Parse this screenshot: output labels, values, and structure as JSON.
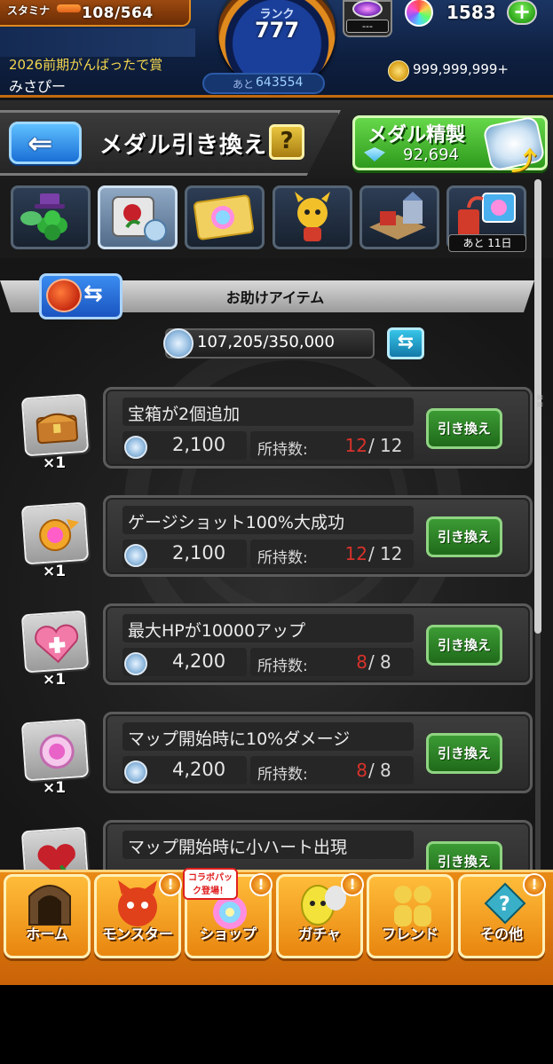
{
  "status": {
    "stamina_label": "スタミナ",
    "stamina_value": "108/564",
    "stamina_fraction": 0.19,
    "rank_label": "ランク",
    "rank_value": "777",
    "rank_next_label": "あと",
    "rank_next_value": "643554",
    "gem_value": "---",
    "orb_value": "1583",
    "orb_plus": "+",
    "title": "2026前期がんばったで賞",
    "username": "みさぴー",
    "coin_value": "999,999,999+"
  },
  "header": {
    "back_icon": "arrow-left-icon",
    "title": "メダル引き換え",
    "help_label": "?",
    "refine_label": "メダル精製",
    "refine_count": "92,694"
  },
  "tabs": {
    "timer": "あと 11日"
  },
  "section": {
    "title": "お助けアイテム",
    "medal_total": "107,205/350,000",
    "sort_icon": "swap-arrows-icon"
  },
  "items": [
    {
      "name": "宝箱が2個追加",
      "qty": "×1",
      "cost": "2,100",
      "owned_label": "所持数:",
      "owned": "12",
      "max": "12",
      "button": "引き換え"
    },
    {
      "name": "ゲージショット100%大成功",
      "qty": "×1",
      "cost": "2,100",
      "owned_label": "所持数:",
      "owned": "12",
      "max": "12",
      "button": "引き換え"
    },
    {
      "name": "最大HPが10000アップ",
      "qty": "×1",
      "cost": "4,200",
      "owned_label": "所持数:",
      "owned": "8",
      "max": "8",
      "button": "引き換え"
    },
    {
      "name": "マップ開始時に10%ダメージ",
      "qty": "×1",
      "cost": "4,200",
      "owned_label": "所持数:",
      "owned": "8",
      "max": "8",
      "button": "引き換え"
    },
    {
      "name": "マップ開始時に小ハート出現",
      "qty": "",
      "cost": "",
      "owned_label": "",
      "owned": "",
      "max": "",
      "button": "引き換え"
    }
  ],
  "nav": {
    "collab_badge": "コラボパック登場！",
    "items": [
      {
        "label": "ホーム",
        "alert": ""
      },
      {
        "label": "モンスター",
        "alert": "!"
      },
      {
        "label": "ショップ",
        "alert": "!"
      },
      {
        "label": "ガチャ",
        "alert": "!"
      },
      {
        "label": "フレンド",
        "alert": ""
      },
      {
        "label": "その他",
        "alert": "!"
      }
    ]
  },
  "colors": {
    "accent_orange": "#e88a14",
    "exchange_green": "#3c9b34",
    "owned_red": "#d8322a",
    "back_blue": "#1a6fd6"
  }
}
